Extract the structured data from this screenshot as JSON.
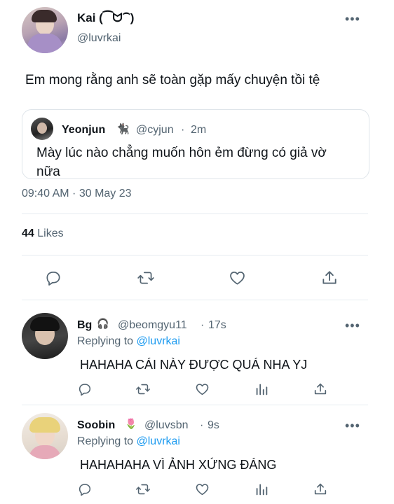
{
  "main_tweet": {
    "display_name": "Kai (⁀ᗢ⁀)",
    "handle": "@luvrkai",
    "text": "Em mong rằng anh sẽ toàn gặp mấy chuyện tồi tệ",
    "quoted": {
      "display_name": "Yeonjun",
      "emoji": "🐈‍⬛",
      "handle": "@cyjun",
      "time": "2m",
      "text": "Mày lúc nào chẳng muốn hôn ẻm đừng có giả vờ nữa"
    },
    "timestamp": "09:40 AM · 30 May 23",
    "likes_count": "44",
    "likes_label": "Likes"
  },
  "replies": [
    {
      "display_name": "Bg",
      "emoji": "🎧",
      "handle": "@beomgyu11",
      "time": "17s",
      "replying_prefix": "Replying to",
      "replying_to": "@luvrkai",
      "text": "HAHAHA CÁI NÀY ĐƯỢC QUÁ NHA YJ"
    },
    {
      "display_name": "Soobin",
      "emoji": "🌷",
      "handle": "@luvsbn",
      "time": "9s",
      "replying_prefix": "Replying to",
      "replying_to": "@luvrkai",
      "text": "HAHAHAHA VÌ ẢNH XỨNG ĐÁNG"
    }
  ],
  "icons": {
    "more": "more-icon",
    "reply": "reply-icon",
    "retweet": "retweet-icon",
    "like": "like-icon",
    "share": "share-icon",
    "analytics": "analytics-icon"
  },
  "colors": {
    "link": "#1d9bf0",
    "muted": "#536471",
    "text": "#0f1419",
    "divider": "#e6ecf0"
  }
}
